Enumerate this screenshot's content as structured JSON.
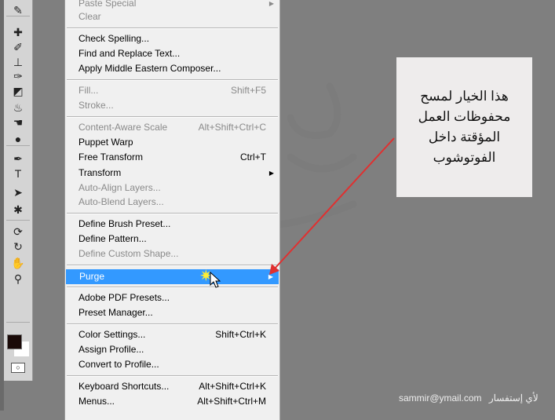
{
  "toolbar": {
    "tools": [
      "eyedropper-icon",
      "spot-healing-icon",
      "brush-icon",
      "clone-stamp-icon",
      "history-brush-icon",
      "eraser-icon",
      "paint-bucket-icon",
      "smudge-icon",
      "dodge-icon",
      "pen-icon",
      "type-icon",
      "path-selection-icon",
      "custom-shape-icon",
      "3d-rotate-icon",
      "3d-orbit-icon",
      "hand-icon",
      "zoom-icon"
    ],
    "glyphs": [
      "✎",
      "✚",
      "✐",
      "⊥",
      "✑",
      "◩",
      "♨",
      "☚",
      "●",
      "✒",
      "T",
      "➤",
      "✱",
      "⟳",
      "↻",
      "✋",
      "⚲"
    ],
    "foreground_color": "#1a0a08",
    "background_color": "#ffffff"
  },
  "menu": {
    "items": [
      {
        "label": "Paste Special",
        "shortcut": "",
        "submenu": true,
        "disabled": true
      },
      {
        "label": "Clear",
        "shortcut": "",
        "disabled": true
      },
      {
        "label": "Check Spelling...",
        "shortcut": ""
      },
      {
        "label": "Find and Replace Text...",
        "shortcut": ""
      },
      {
        "label": "Apply Middle Eastern Composer...",
        "shortcut": ""
      },
      {
        "label": "Fill...",
        "shortcut": "Shift+F5",
        "disabled": true
      },
      {
        "label": "Stroke...",
        "shortcut": "",
        "disabled": true
      },
      {
        "label": "Content-Aware Scale",
        "shortcut": "Alt+Shift+Ctrl+C",
        "disabled": true
      },
      {
        "label": "Puppet Warp",
        "shortcut": ""
      },
      {
        "label": "Free Transform",
        "shortcut": "Ctrl+T"
      },
      {
        "label": "Transform",
        "shortcut": "",
        "submenu": true
      },
      {
        "label": "Auto-Align Layers...",
        "shortcut": "",
        "disabled": true
      },
      {
        "label": "Auto-Blend Layers...",
        "shortcut": "",
        "disabled": true
      },
      {
        "label": "Define Brush Preset...",
        "shortcut": ""
      },
      {
        "label": "Define Pattern...",
        "shortcut": ""
      },
      {
        "label": "Define Custom Shape...",
        "shortcut": "",
        "disabled": true
      },
      {
        "label": "Purge",
        "shortcut": "",
        "submenu": true,
        "highlighted": true
      },
      {
        "label": "Adobe PDF Presets...",
        "shortcut": ""
      },
      {
        "label": "Preset Manager...",
        "shortcut": ""
      },
      {
        "label": "Color Settings...",
        "shortcut": "Shift+Ctrl+K"
      },
      {
        "label": "Assign Profile...",
        "shortcut": ""
      },
      {
        "label": "Convert to Profile...",
        "shortcut": ""
      },
      {
        "label": "Keyboard Shortcuts...",
        "shortcut": "Alt+Shift+Ctrl+K"
      },
      {
        "label": "Menus...",
        "shortcut": "Alt+Shift+Ctrl+M"
      }
    ],
    "highlight_color": "#3399ff"
  },
  "note": {
    "lines": [
      "هذا الخيار لمسح",
      "محفوظات العمل",
      "المؤقتة داخل",
      "الفوتوشوب"
    ]
  },
  "footer": {
    "email": "sammir@ymail.com",
    "label": "لأي إستفسار"
  },
  "watermark": {
    "text": "سمير العيداني"
  },
  "arrow_color": "#e03030"
}
